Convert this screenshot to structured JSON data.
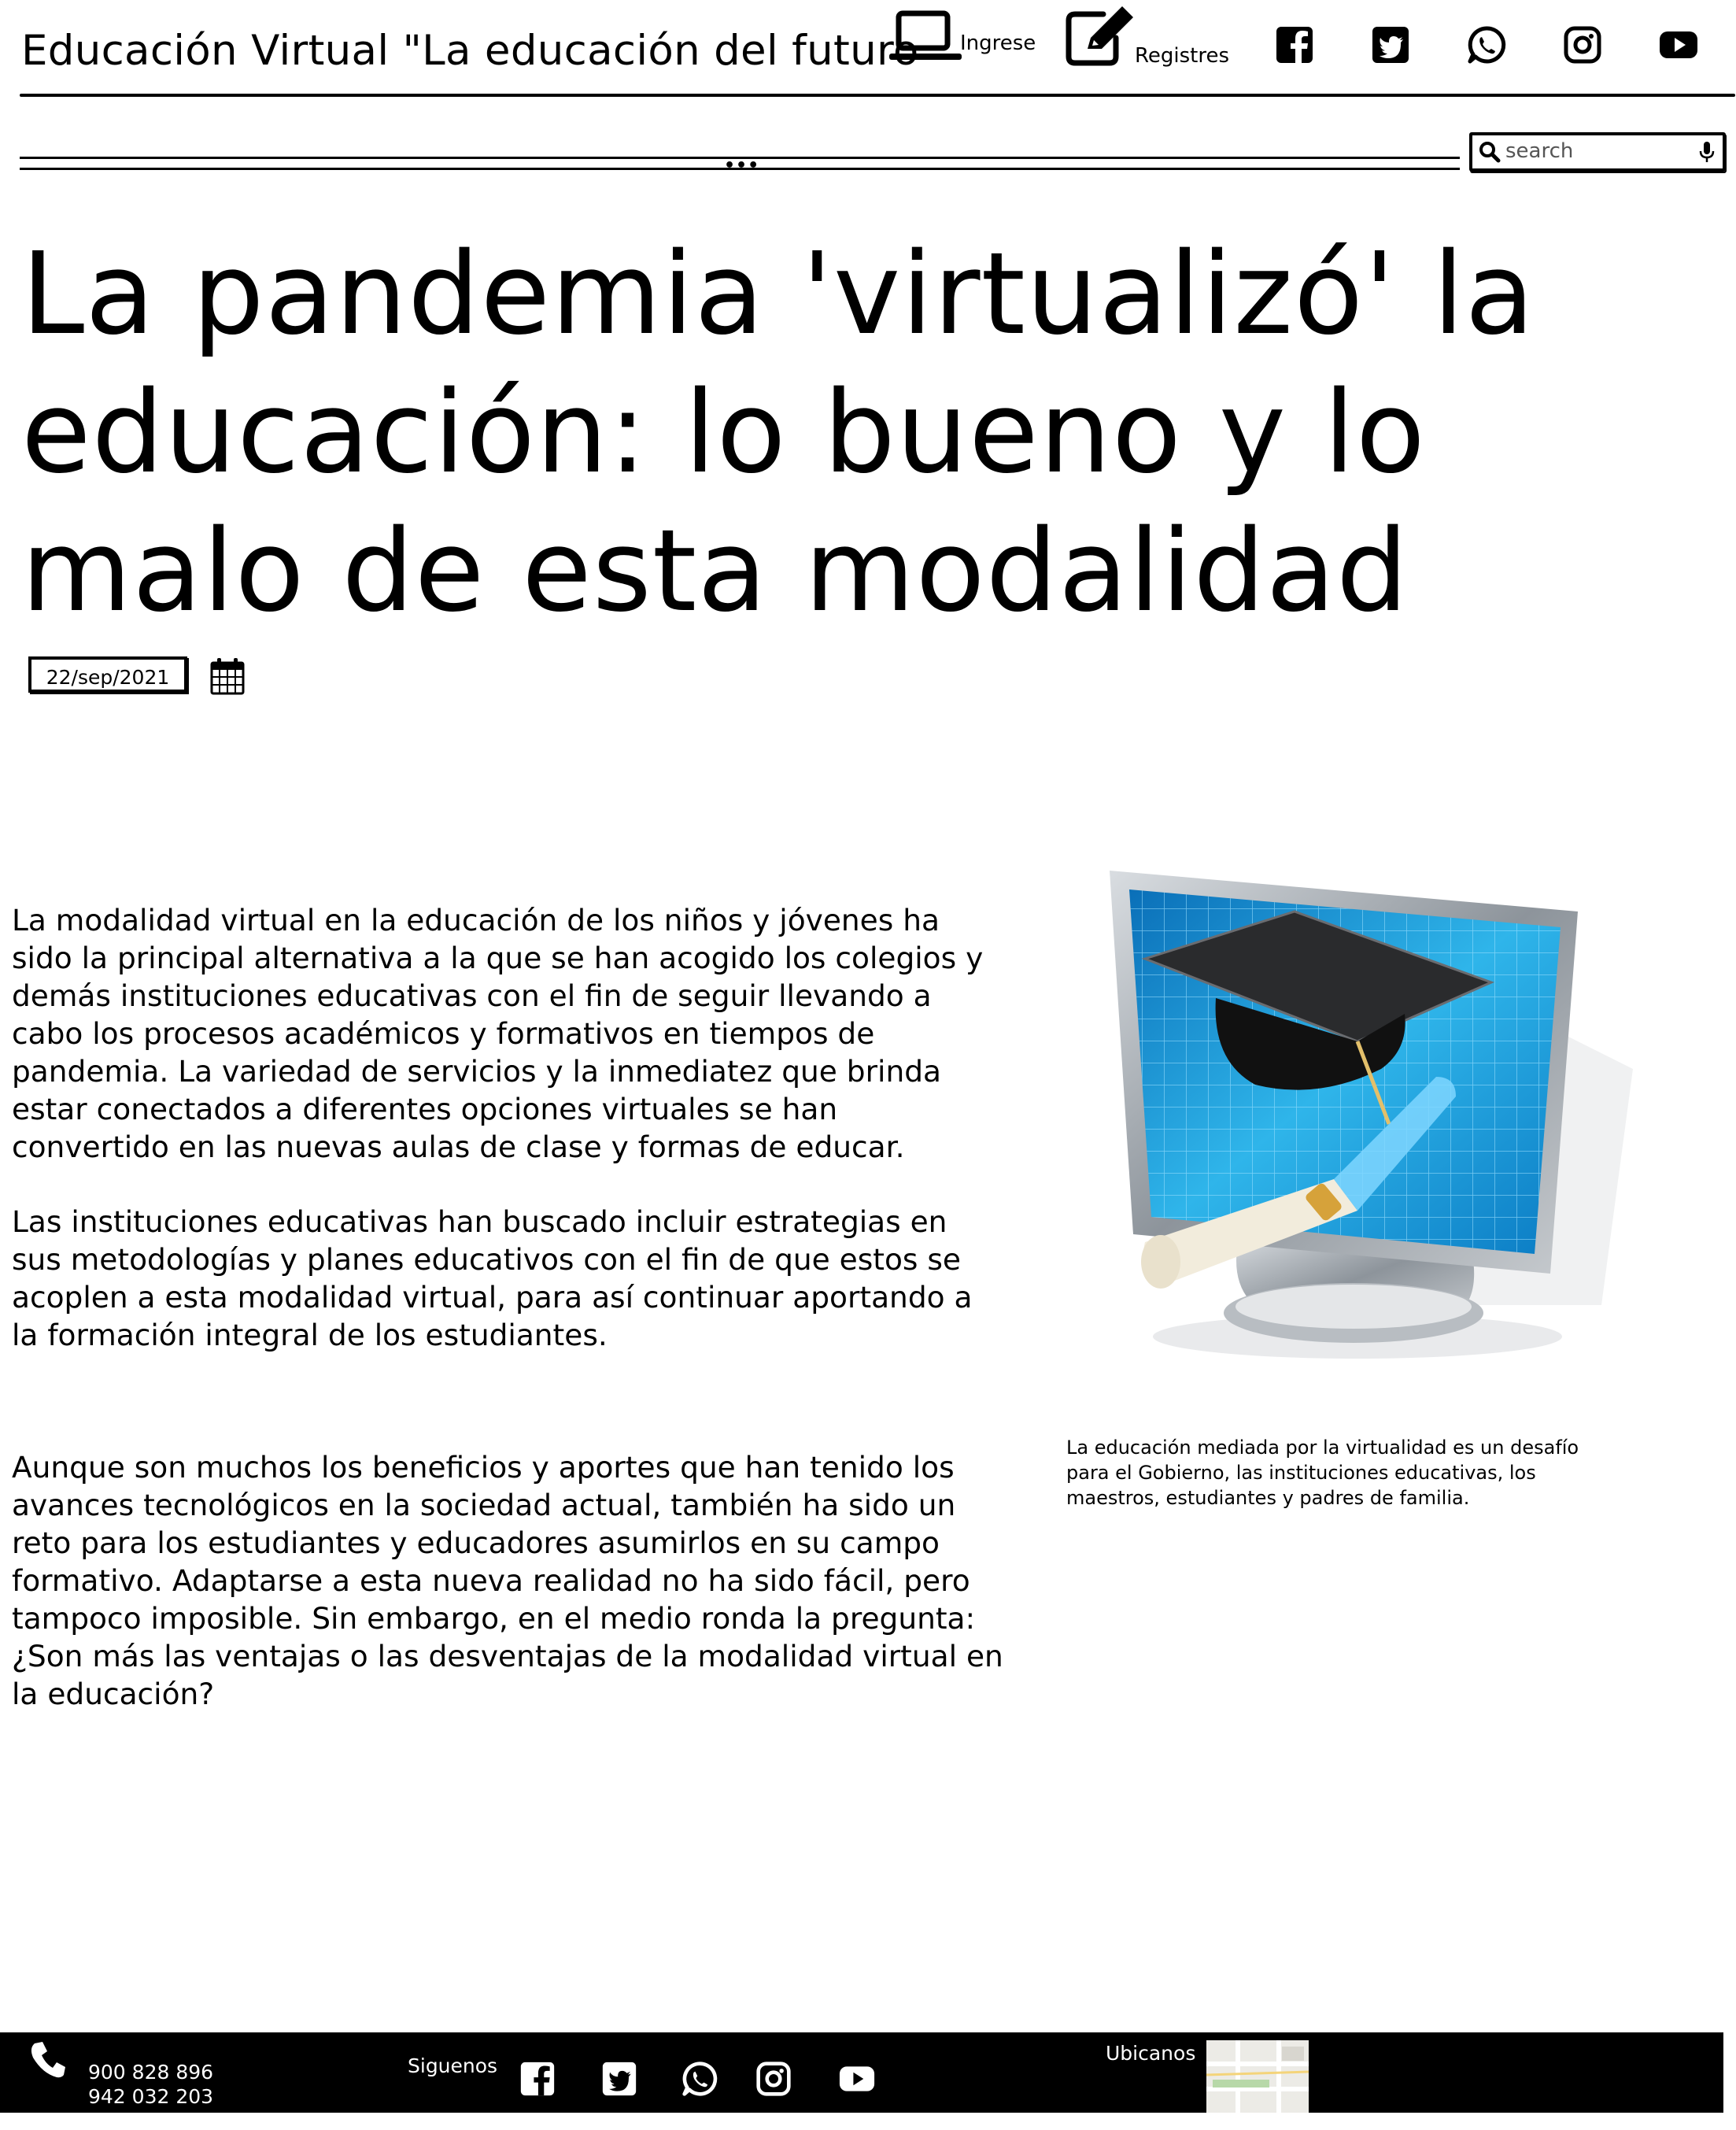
{
  "header": {
    "site_title": "Educación Virtual \"La educación del futuro",
    "login_label": "Ingrese",
    "register_label": "Registres",
    "social_icons": [
      "facebook-icon",
      "twitter-icon",
      "whatsapp-icon",
      "instagram-icon",
      "youtube-icon"
    ]
  },
  "nav": {
    "more_label": "•••",
    "search_placeholder": "search"
  },
  "article": {
    "headline": "La pandemia 'virtualizó' la educación: lo bueno y lo malo de esta modalidad",
    "date": "22/sep/2021",
    "paragraphs": [
      "La modalidad virtual en la educación de los niños y jóvenes ha sido la principal alternativa a la que se han acogido los colegios y demás instituciones educativas con el fin de seguir llevando a cabo los procesos académicos y formativos en tiempos de pandemia. La variedad de servicios y la inmediatez que brinda estar conectados a diferentes opciones virtuales se han convertido en las nuevas aulas de clase y formas de educar.",
      "Las instituciones educativas han buscado incluir estrategias en sus metodologías y planes educativos con el fin de que estos se acoplen a esta modalidad virtual, para así continuar aportando a la formación integral de los estudiantes.",
      "Aunque son muchos los beneficios y aportes que han tenido los avances tecnológicos en la sociedad actual, también ha sido un reto para los estudiantes y educadores asumirlos en su campo formativo. Adaptarse a esta nueva realidad no ha sido fácil, pero tampoco imposible. Sin embargo, en el medio ronda la pregunta: ¿Son más las ventajas o las desventajas de la modalidad virtual en la educación?"
    ],
    "image_caption": "La educación mediada por la virtualidad es un desafío para el Gobierno, las instituciones educativas, los maestros, estudiantes y padres de familia."
  },
  "footer": {
    "phone_1": "900 828 896",
    "phone_2": "942 032 203",
    "follow_label": "Siguenos",
    "location_label": "Ubicanos",
    "social_icons": [
      "facebook-icon",
      "twitter-icon",
      "whatsapp-icon",
      "instagram-icon",
      "youtube-icon"
    ]
  }
}
